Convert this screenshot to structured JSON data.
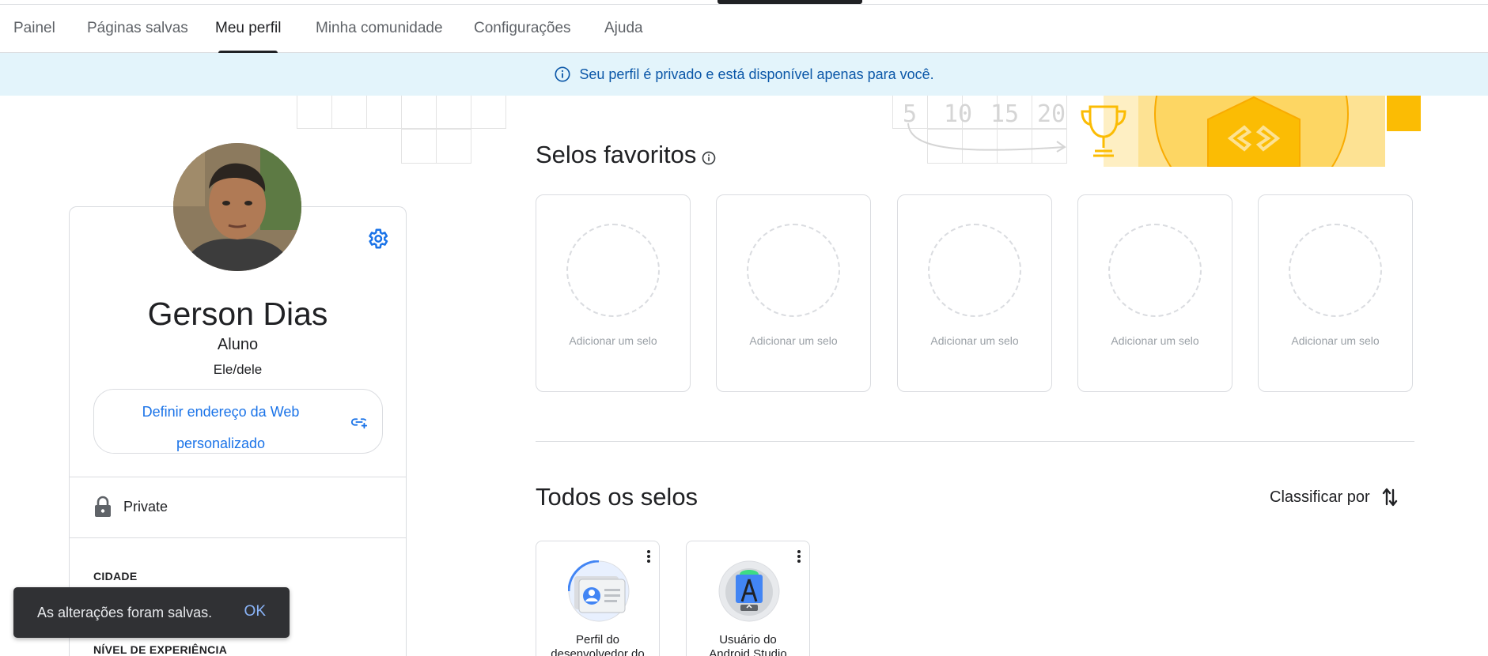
{
  "nav": {
    "tabs": [
      {
        "label": "Painel",
        "active": false
      },
      {
        "label": "Páginas salvas",
        "active": false
      },
      {
        "label": "Meu perfil",
        "active": true
      },
      {
        "label": "Minha comunidade",
        "active": false
      },
      {
        "label": "Configurações",
        "active": false
      },
      {
        "label": "Ajuda",
        "active": false
      }
    ]
  },
  "banner": {
    "text": "Seu perfil é privado e está disponível apenas para você.",
    "icon": "info-icon"
  },
  "deco": {
    "numbers": [
      "5",
      "10",
      "15",
      "20"
    ]
  },
  "profile": {
    "name": "Gerson Dias",
    "role": "Aluno",
    "pronouns": "Ele/dele",
    "web_address_line1": "Definir endereço da Web",
    "web_address_line2": "personalizado",
    "privacy": "Private",
    "city_label": "CIDADE",
    "experience_label": "NÍVEL DE EXPERIÊNCIA"
  },
  "favorites": {
    "title": "Selos favoritos",
    "slots": [
      "Adicionar um selo",
      "Adicionar um selo",
      "Adicionar um selo",
      "Adicionar um selo",
      "Adicionar um selo"
    ]
  },
  "all_badges": {
    "title": "Todos os selos",
    "sort_label": "Classificar por",
    "badges": [
      {
        "line1": "Perfil do",
        "line2": "desenvolvedor do"
      },
      {
        "line1": "Usuário do",
        "line2": "Android Studio"
      }
    ]
  },
  "snackbar": {
    "message": "As alterações foram salvas.",
    "action": "OK"
  },
  "colors": {
    "accent": "#1a73e8",
    "banner_bg": "#e3f4fb",
    "banner_text": "#0b57a8",
    "deco_yellow": "#fde293"
  }
}
